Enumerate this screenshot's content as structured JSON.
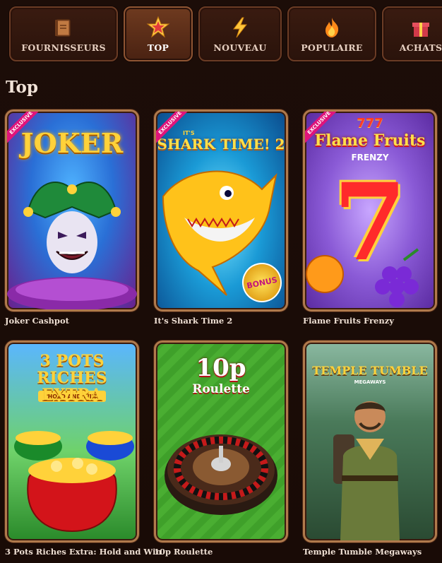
{
  "tabs": [
    {
      "label": "FOURNISSEURS",
      "icon": "book-icon",
      "active": false
    },
    {
      "label": "TOP",
      "icon": "star-icon",
      "active": true
    },
    {
      "label": "NOUVEAU",
      "icon": "lightning-icon",
      "active": false
    },
    {
      "label": "POPULAIRE",
      "icon": "flame-icon",
      "active": false
    },
    {
      "label": "ACHATS",
      "icon": "gift-icon",
      "active": false
    }
  ],
  "section": {
    "title": "Top"
  },
  "badge": {
    "exclusive": "EXCLUSIVE"
  },
  "games": [
    {
      "name": "Joker Cashpot",
      "art": {
        "title": "JOKER"
      }
    },
    {
      "name": "It's Shark Time 2",
      "art": {
        "small": "IT'S",
        "title": "SHARK TIME! 2",
        "badge": "BONUS"
      }
    },
    {
      "name": "Flame Fruits Frenzy",
      "art": {
        "top": "777",
        "title": "Flame Fruits",
        "sub": "FRENZY",
        "number": "7"
      }
    },
    {
      "name": "3 Pots Riches Extra: Hold and Win",
      "art": {
        "title": "3 POTS RICHES EXTRA",
        "sub": "HOLD AND WIN"
      }
    },
    {
      "name": "10p Roulette",
      "art": {
        "title": "10p",
        "sub": "Roulette"
      }
    },
    {
      "name": "Temple Tumble Megaways",
      "art": {
        "title": "TEMPLE TUMBLE",
        "sub": "MEGAWAYS"
      }
    }
  ]
}
